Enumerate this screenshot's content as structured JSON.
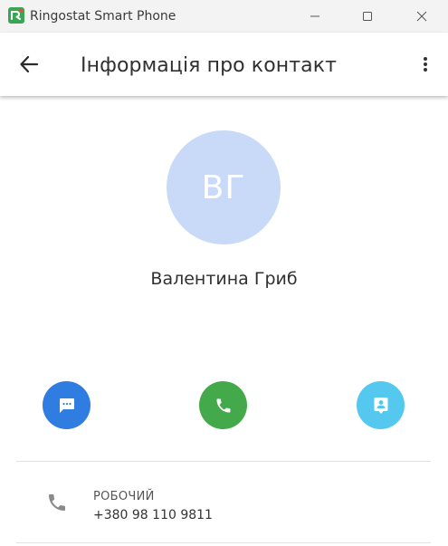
{
  "window": {
    "title": "Ringostat Smart Phone",
    "icons": {
      "logo": "ringostat-logo-icon",
      "minimize": "minimize-icon",
      "maximize": "maximize-icon",
      "close": "close-icon"
    }
  },
  "appbar": {
    "title": "Інформація про контакт",
    "icons": {
      "back": "arrow-back-icon",
      "more": "more-vertical-icon"
    }
  },
  "contact": {
    "initials": "ВГ",
    "name": "Валентина Гриб",
    "avatar_color": "#c9daf8"
  },
  "actions": [
    {
      "id": "message",
      "icon": "message-icon",
      "color": "#2f7de1"
    },
    {
      "id": "call",
      "icon": "phone-icon",
      "color": "#43a94a"
    },
    {
      "id": "contact-card",
      "icon": "contact-card-icon",
      "color": "#55c8f0"
    }
  ],
  "phones": [
    {
      "type": "РОБОЧИЙ",
      "number": "+380 98 110 9811",
      "icon": "phone-icon"
    }
  ]
}
